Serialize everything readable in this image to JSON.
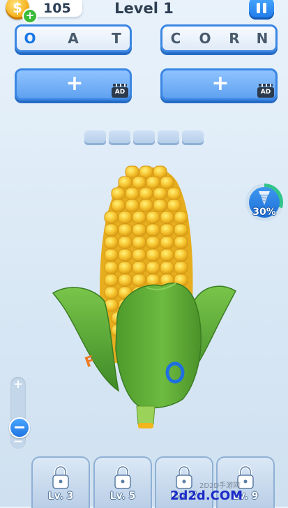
{
  "coins": {
    "count": "105",
    "coin_symbol": "$",
    "add_symbol": "+"
  },
  "level": {
    "title": "Level 1"
  },
  "words": [
    {
      "letters": [
        "O",
        "A",
        "T"
      ],
      "found": [
        true,
        false,
        false
      ]
    },
    {
      "letters": [
        "C",
        "O",
        "R",
        "N"
      ],
      "found": [
        false,
        false,
        false,
        false
      ]
    }
  ],
  "hint_buttons": [
    {
      "symbol": "+",
      "ad_label": "AD"
    },
    {
      "symbol": "+",
      "ad_label": "AD"
    }
  ],
  "answer_slots": 5,
  "progress": {
    "label": "30%",
    "value": 0.3
  },
  "zoom": {
    "plus": "+",
    "minus": "−"
  },
  "tools": [
    {
      "label": "Lv. 3"
    },
    {
      "label": "Lv. 5"
    },
    {
      "label": "Lv. 7"
    },
    {
      "label": "Lv. 9"
    }
  ],
  "watermark": {
    "main": "2d2d.COM",
    "small": "2D2D手游网"
  },
  "colors": {
    "accent": "#3a86e3",
    "corn": "#f7c531",
    "husk": "#5fae34",
    "progress": "#32c48a"
  }
}
